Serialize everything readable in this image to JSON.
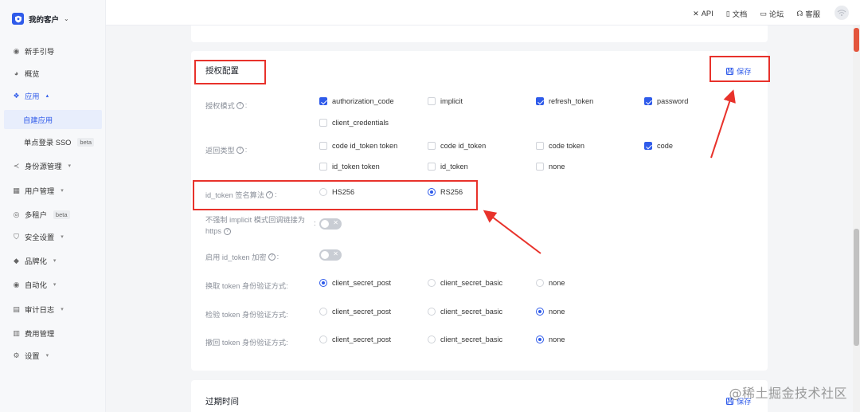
{
  "brand": {
    "name": "我的客户"
  },
  "sidebar": {
    "items": [
      {
        "label": "新手引导",
        "icon": "compass-icon"
      },
      {
        "label": "概览",
        "icon": "pie-chart-icon"
      },
      {
        "label": "应用",
        "icon": "apps-icon"
      },
      {
        "label": "自建应用"
      },
      {
        "label": "单点登录 SSO",
        "badge": "beta"
      },
      {
        "label": "身份源管理",
        "icon": "share-icon"
      },
      {
        "label": "用户管理",
        "icon": "users-icon"
      },
      {
        "label": "多租户",
        "badge": "beta",
        "icon": "tenant-icon"
      },
      {
        "label": "安全设置",
        "icon": "shield-icon"
      },
      {
        "label": "品牌化",
        "icon": "brush-icon"
      },
      {
        "label": "自动化",
        "icon": "automation-icon"
      },
      {
        "label": "审计日志",
        "icon": "log-icon"
      },
      {
        "label": "费用管理",
        "icon": "bill-icon"
      },
      {
        "label": "设置",
        "icon": "gear-icon"
      }
    ]
  },
  "topbar": {
    "api": "API",
    "docs": "文档",
    "forum": "论坛",
    "support": "客服"
  },
  "section": {
    "title": "授权配置",
    "save_label": "保存",
    "grant_types": {
      "label": "授权模式",
      "options": [
        {
          "label": "authorization_code",
          "checked": true
        },
        {
          "label": "implicit",
          "checked": false
        },
        {
          "label": "refresh_token",
          "checked": true
        },
        {
          "label": "password",
          "checked": true
        },
        {
          "label": "client_credentials",
          "checked": false
        }
      ]
    },
    "response_types": {
      "label": "返回类型",
      "options": [
        {
          "label": "code id_token token",
          "checked": false
        },
        {
          "label": "code id_token",
          "checked": false
        },
        {
          "label": "code token",
          "checked": false
        },
        {
          "label": "code",
          "checked": true
        },
        {
          "label": "id_token token",
          "checked": false
        },
        {
          "label": "id_token",
          "checked": false
        },
        {
          "label": "none",
          "checked": false
        }
      ]
    },
    "id_token_alg": {
      "label": "id_token 签名算法",
      "options": [
        {
          "label": "HS256",
          "selected": false
        },
        {
          "label": "RS256",
          "selected": true
        }
      ]
    },
    "implicit_https": {
      "label_line1": "不强制 implicit 模式回调链接为",
      "label_line2": "https",
      "enabled": false
    },
    "id_token_encrypt": {
      "label": "启用 id_token 加密",
      "enabled": false
    },
    "token_auth": {
      "label": "换取 token 身份验证方式:",
      "options": [
        "client_secret_post",
        "client_secret_basic",
        "none"
      ],
      "selected": "client_secret_post"
    },
    "introspect_auth": {
      "label": "检验 token 身份验证方式:",
      "options": [
        "client_secret_post",
        "client_secret_basic",
        "none"
      ],
      "selected": "none"
    },
    "revoke_auth": {
      "label": "撤回 token 身份验证方式:",
      "options": [
        "client_secret_post",
        "client_secret_basic",
        "none"
      ],
      "selected": "none"
    }
  },
  "next_section": {
    "title": "过期时间",
    "save_label": "保存"
  },
  "watermark": "@稀土掘金技术社区",
  "colors": {
    "accent": "#2f5bea",
    "highlight": "#e8322b"
  }
}
